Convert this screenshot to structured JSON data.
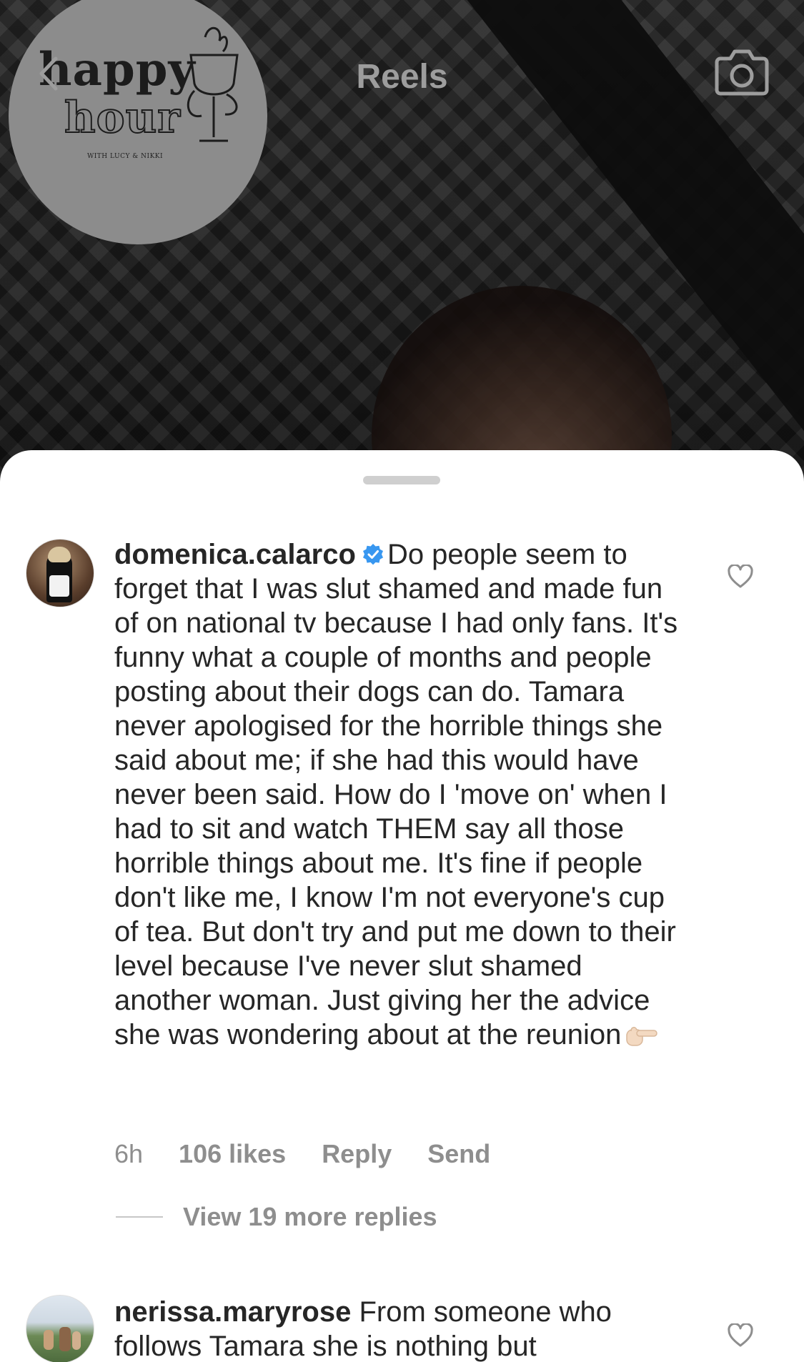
{
  "header": {
    "title": "Reels"
  },
  "logo": {
    "line1": "happy",
    "line2": "hour",
    "tagline": "WITH LUCY & NIKKI"
  },
  "comments": [
    {
      "username": "domenica.calarco",
      "verified": true,
      "text": "Do people seem to forget that I was slut shamed and made fun of on national tv because I had only fans. It's funny what a couple of months and people posting about their dogs can do. Tamara never apologised for the horrible things she said about me; if she had this would have never been said. How do I 'move on' when I had to sit and watch THEM say all those horrible things about me. It's fine if people don't like me, I know I'm not everyone's cup of tea. But don't try and put me down to their level because I've never slut shamed another woman. Just giving her the advice she was wondering about at the reunion",
      "emoji": "backhand-index-pointing-right",
      "time": "6h",
      "likes": "106 likes",
      "reply_label": "Reply",
      "send_label": "Send",
      "view_replies": "View 19 more replies"
    },
    {
      "username": "nerissa.maryrose",
      "verified": false,
      "text": "From someone who follows Tamara she is nothing but"
    }
  ]
}
